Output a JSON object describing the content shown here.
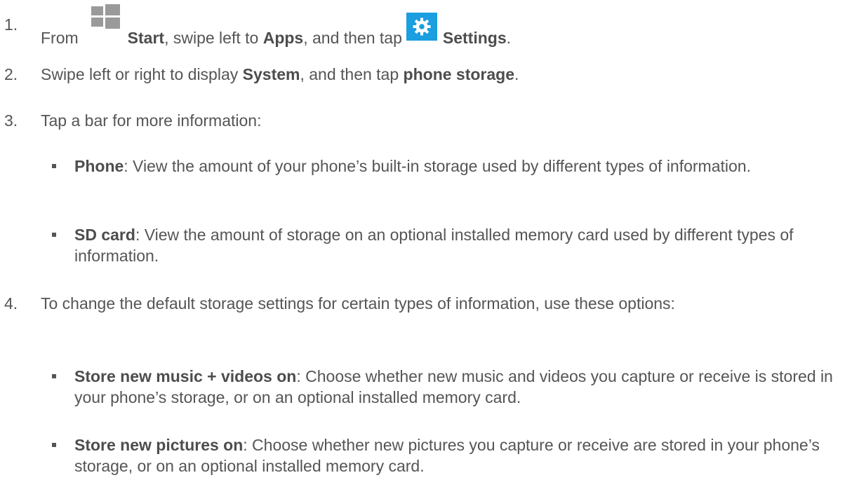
{
  "steps": [
    {
      "num": "1.",
      "parts": {
        "a": "From",
        "start": "Start",
        "b": ", swipe left to",
        "apps": "Apps",
        "c": ", and then tap",
        "settings": "Settings",
        "d": "."
      }
    },
    {
      "num": "2.",
      "parts": {
        "a": "Swipe left or right to display",
        "system": "System",
        "b": ", and then tap",
        "phone_storage": "phone storage",
        "c": "."
      }
    },
    {
      "num": "3.",
      "text": "Tap a bar for more information:",
      "bullets": [
        {
          "label": "Phone",
          "text": ": View the amount of your phone’s built-in storage used by different types of information."
        },
        {
          "label": "SD card",
          "text": ": View the amount of storage on an optional installed memory card used by different types of information."
        }
      ]
    },
    {
      "num": "4.",
      "text": "To change the default storage settings for certain types of information, use these options:",
      "bullets": [
        {
          "label": "Store new music + videos on",
          "text": ": Choose whether new music and videos you capture or receive is stored in your phone’s storage, or on an optional installed memory card."
        },
        {
          "label": "Store new pictures on",
          "text": ": Choose whether new pictures you capture or receive are stored in your phone’s storage, or on an optional installed memory card."
        }
      ]
    }
  ],
  "icons": {
    "start": "windows-start-icon",
    "settings": "settings-gear-icon"
  },
  "colors": {
    "text": "#555555",
    "start_icon": "#9a9a9a",
    "settings_tile": "#1b9fe0"
  }
}
